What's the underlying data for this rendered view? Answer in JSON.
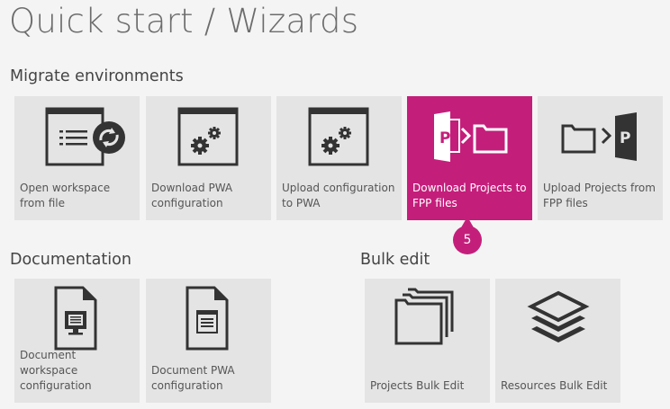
{
  "page_title": "Quick start / Wizards",
  "sections": {
    "migrate": "Migrate environments",
    "documentation": "Documentation",
    "bulk_edit": "Bulk edit"
  },
  "tiles": {
    "open_workspace": {
      "label": "Open workspace from file",
      "icon": "open-workspace-icon"
    },
    "download_pwa": {
      "label": "Download PWA configuration",
      "icon": "gears-window-icon"
    },
    "upload_config": {
      "label": "Upload configuration to PWA",
      "icon": "gears-window-icon"
    },
    "download_projects": {
      "label": "Download Projects to FPP files",
      "icon": "project-to-folder-icon"
    },
    "upload_projects": {
      "label": "Upload Projects from FPP files",
      "icon": "folder-to-project-icon"
    },
    "doc_workspace": {
      "label": "Document workspace configuration",
      "icon": "document-monitor-icon"
    },
    "doc_pwa": {
      "label": "Document PWA configuration",
      "icon": "document-window-icon"
    },
    "projects_bulk": {
      "label": "Projects Bulk Edit",
      "icon": "stacked-folders-icon"
    },
    "resources_bulk": {
      "label": "Resources Bulk Edit",
      "icon": "layers-icon"
    }
  },
  "callout_badge": "5",
  "colors": {
    "accent": "#c41e7b",
    "tile_bg": "#e4e4e4",
    "background": "#f4f4f4"
  }
}
